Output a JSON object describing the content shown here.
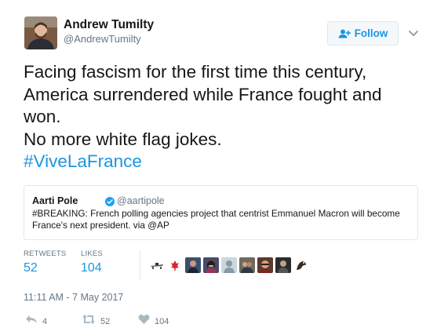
{
  "author": {
    "name": "Andrew Tumilty",
    "handle": "@AndrewTumilty",
    "avatar_icon": "person-avatar"
  },
  "follow_button": {
    "label": "Follow",
    "icon": "add-user-icon"
  },
  "more_menu": {
    "icon": "chevron-down-icon"
  },
  "tweet": {
    "lines": [
      "Facing fascism for the first time this century,",
      "America surrendered while France fought and",
      "won.",
      "No more white flag jokes."
    ],
    "hashtag": "#ViveLaFrance"
  },
  "quoted_tweet": {
    "name": "Aarti Pole",
    "handle": "@aartipole",
    "verified": true,
    "text": "#BREAKING: French polling agencies project that centrist Emmanuel Macron will become France's next president. via @AP"
  },
  "stats": {
    "retweets_label": "RETWEETS",
    "retweets_value": "52",
    "likes_label": "LIKES",
    "likes_value": "104",
    "liker_avatars": [
      "liker-1",
      "liker-2",
      "liker-3",
      "liker-4",
      "liker-5",
      "liker-6",
      "liker-7",
      "liker-8",
      "liker-9",
      "liker-10"
    ]
  },
  "timestamp": "11:11 AM - 7 May 2017",
  "actions": {
    "reply_count": "4",
    "retweet_count": "52",
    "like_count": "104"
  },
  "colors": {
    "accent": "#1b95e0",
    "text": "#14171a",
    "muted": "#657786",
    "border": "#e1e8ed"
  }
}
